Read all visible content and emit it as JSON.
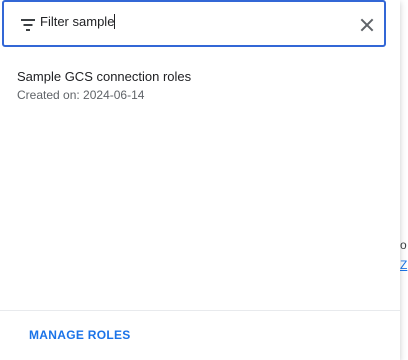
{
  "filter": {
    "icon": "filter-icon",
    "label": "Filter",
    "value": "sample",
    "clear_icon": "close-icon"
  },
  "results": [
    {
      "title": "Sample GCS connection roles",
      "subtitle": "Created on: 2024-06-14"
    }
  ],
  "footer": {
    "manage_roles_label": "MANAGE ROLES"
  },
  "background": {
    "right_text": "o",
    "right_link": "Z"
  },
  "colors": {
    "accent": "#1a73e8",
    "focus_border": "#3367d6",
    "text_primary": "#202124",
    "text_secondary": "#5f6368"
  }
}
